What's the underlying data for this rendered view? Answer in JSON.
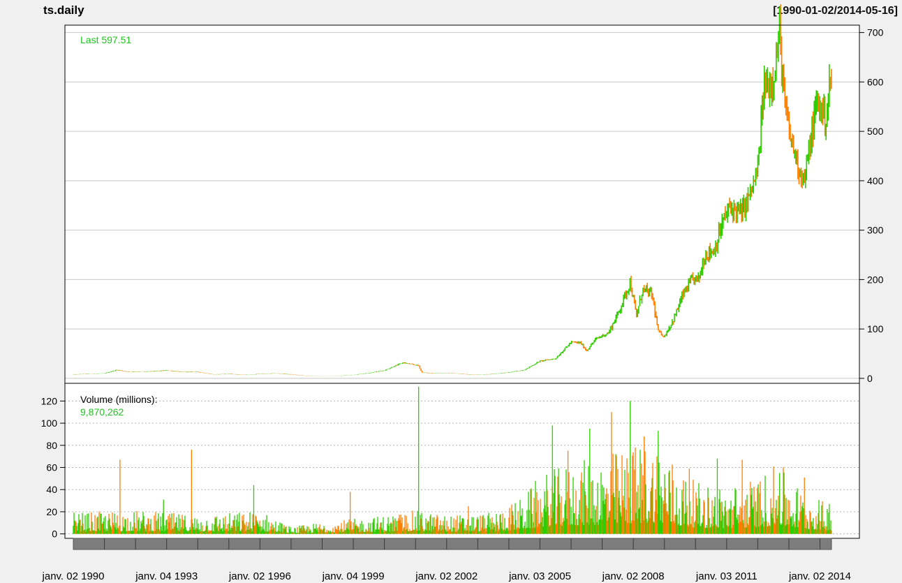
{
  "chart_data": {
    "type": "candlestick",
    "title": "ts.daily",
    "date_range": "[1990-01-02/2014-05-16]",
    "grid": true,
    "colors": {
      "up": "#2ecc00",
      "down": "#ff7f00",
      "grid": "#c8c8c8",
      "background": "#ffffff",
      "page": "#f0f0f0"
    },
    "price": {
      "legend": "Last 597.51",
      "last": 597.51,
      "axis_side": "right",
      "ylim": [
        -10,
        715
      ],
      "ticks": [
        0,
        100,
        200,
        300,
        400,
        500,
        600,
        700
      ],
      "points": [
        [
          1990.0,
          8
        ],
        [
          1990.5,
          9
        ],
        [
          1991.0,
          10
        ],
        [
          1991.4,
          17
        ],
        [
          1991.8,
          13
        ],
        [
          1992.5,
          14
        ],
        [
          1993.0,
          16
        ],
        [
          1993.5,
          13
        ],
        [
          1994.0,
          13
        ],
        [
          1994.5,
          8
        ],
        [
          1995.0,
          9
        ],
        [
          1995.5,
          7
        ],
        [
          1996.0,
          9
        ],
        [
          1996.5,
          10
        ],
        [
          1997.0,
          8
        ],
        [
          1997.5,
          5
        ],
        [
          1998.0,
          4
        ],
        [
          1998.5,
          5
        ],
        [
          1999.0,
          7
        ],
        [
          1999.5,
          11
        ],
        [
          2000.0,
          16
        ],
        [
          2000.3,
          24
        ],
        [
          2000.6,
          32
        ],
        [
          2000.9,
          28
        ],
        [
          2001.1,
          26
        ],
        [
          2001.2,
          12
        ],
        [
          2001.6,
          10
        ],
        [
          2002.0,
          11
        ],
        [
          2002.5,
          9
        ],
        [
          2003.0,
          7
        ],
        [
          2003.5,
          9
        ],
        [
          2004.0,
          12
        ],
        [
          2004.5,
          17
        ],
        [
          2005.0,
          35
        ],
        [
          2005.5,
          40
        ],
        [
          2006.0,
          73
        ],
        [
          2006.3,
          72
        ],
        [
          2006.5,
          56
        ],
        [
          2006.8,
          80
        ],
        [
          2007.2,
          92
        ],
        [
          2007.5,
          130
        ],
        [
          2007.9,
          195
        ],
        [
          2008.1,
          125
        ],
        [
          2008.3,
          180
        ],
        [
          2008.6,
          170
        ],
        [
          2008.8,
          95
        ],
        [
          2009.0,
          85
        ],
        [
          2009.3,
          120
        ],
        [
          2009.6,
          170
        ],
        [
          2009.9,
          200
        ],
        [
          2010.1,
          200
        ],
        [
          2010.3,
          250
        ],
        [
          2010.6,
          260
        ],
        [
          2010.9,
          320
        ],
        [
          2011.1,
          345
        ],
        [
          2011.5,
          335
        ],
        [
          2011.8,
          380
        ],
        [
          2012.0,
          420
        ],
        [
          2012.2,
          590
        ],
        [
          2012.45,
          600
        ],
        [
          2012.6,
          650
        ],
        [
          2012.7,
          700
        ],
        [
          2012.85,
          560
        ],
        [
          2013.0,
          500
        ],
        [
          2013.3,
          430
        ],
        [
          2013.5,
          400
        ],
        [
          2013.7,
          480
        ],
        [
          2013.9,
          560
        ],
        [
          2014.0,
          550
        ],
        [
          2014.2,
          525
        ],
        [
          2014.3,
          590
        ],
        [
          2014.37,
          597
        ]
      ]
    },
    "volume": {
      "legend_label": "Volume (millions):",
      "legend_value": "9,870,262",
      "axis_side": "left",
      "ylim": [
        -4,
        136
      ],
      "ticks": [
        0,
        20,
        40,
        60,
        80,
        100,
        120
      ],
      "level": [
        [
          1990.0,
          9
        ],
        [
          1992.0,
          10
        ],
        [
          1994.0,
          8
        ],
        [
          1996.0,
          10
        ],
        [
          1997.0,
          3
        ],
        [
          1998.0,
          5
        ],
        [
          1999.5,
          7
        ],
        [
          2001.0,
          10
        ],
        [
          2002.0,
          8
        ],
        [
          2003.5,
          9
        ],
        [
          2004.5,
          16
        ],
        [
          2005.0,
          25
        ],
        [
          2006.0,
          30
        ],
        [
          2007.0,
          33
        ],
        [
          2008.0,
          38
        ],
        [
          2008.8,
          40
        ],
        [
          2009.5,
          28
        ],
        [
          2010.0,
          22
        ],
        [
          2011.0,
          20
        ],
        [
          2012.0,
          24
        ],
        [
          2012.7,
          30
        ],
        [
          2013.5,
          18
        ],
        [
          2014.37,
          12
        ]
      ],
      "spikes": [
        [
          1991.5,
          67
        ],
        [
          1992.9,
          31
        ],
        [
          1993.8,
          76
        ],
        [
          1995.8,
          44
        ],
        [
          1998.9,
          38
        ],
        [
          2001.1,
          133
        ],
        [
          2002.7,
          25
        ],
        [
          2005.4,
          98
        ],
        [
          2005.9,
          75
        ],
        [
          2006.6,
          95
        ],
        [
          2007.3,
          110
        ],
        [
          2007.9,
          120
        ],
        [
          2008.35,
          88
        ],
        [
          2008.8,
          93
        ],
        [
          2009.8,
          59
        ],
        [
          2010.7,
          68
        ],
        [
          2011.5,
          67
        ],
        [
          2012.7,
          55
        ],
        [
          2013.5,
          51
        ],
        [
          2014.3,
          27
        ]
      ]
    },
    "x_axis": {
      "range": [
        1989.8,
        2014.6
      ],
      "labels": [
        {
          "label": "janv. 02 1990",
          "x": 1990.0
        },
        {
          "label": "janv. 04 1993",
          "x": 1993.0
        },
        {
          "label": "janv. 02 1996",
          "x": 1996.0
        },
        {
          "label": "janv. 04 1999",
          "x": 1999.0
        },
        {
          "label": "janv. 02 2002",
          "x": 2002.0
        },
        {
          "label": "janv. 03 2005",
          "x": 2005.0
        },
        {
          "label": "janv. 02 2008",
          "x": 2008.0
        },
        {
          "label": "janv. 03 2011",
          "x": 2011.0
        },
        {
          "label": "janv. 02 2014",
          "x": 2014.0
        }
      ]
    }
  }
}
